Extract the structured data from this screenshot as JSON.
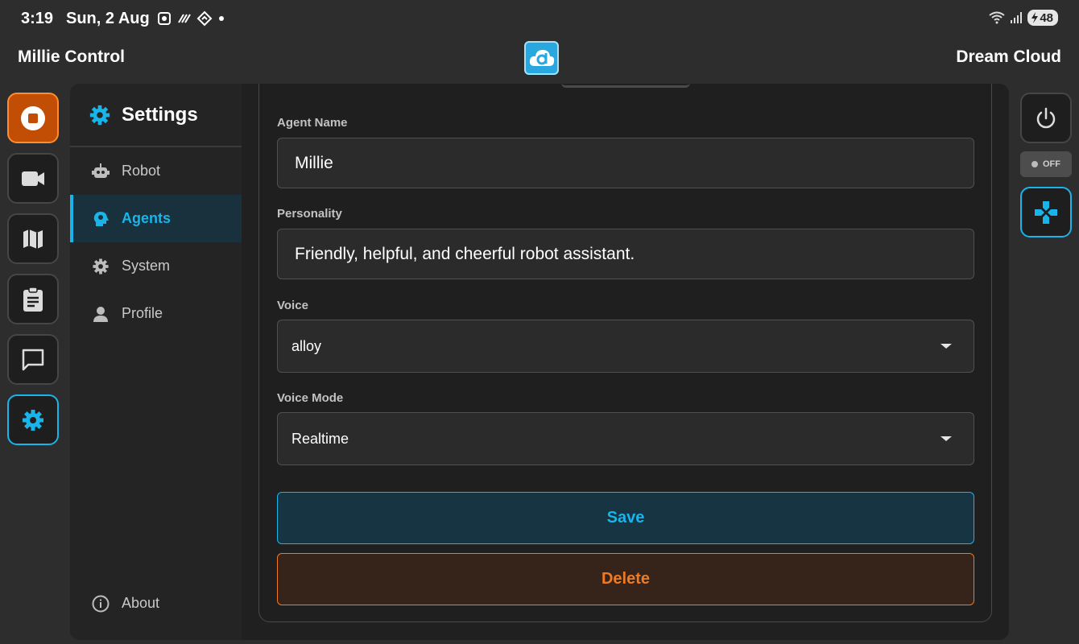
{
  "status_bar": {
    "time": "3:19",
    "date": "Sun, 2 Aug",
    "battery": "48"
  },
  "header": {
    "app_title": "Millie Control",
    "brand": "Dream Cloud",
    "logo_letter": "d"
  },
  "left_nav": [
    "stop",
    "camera",
    "map",
    "tasks",
    "chat",
    "settings"
  ],
  "settings": {
    "title": "Settings",
    "items": [
      {
        "label": "Robot",
        "icon": "robot-icon"
      },
      {
        "label": "Agents",
        "icon": "agent-icon",
        "active": true
      },
      {
        "label": "System",
        "icon": "gear-icon"
      },
      {
        "label": "Profile",
        "icon": "person-icon"
      }
    ],
    "about": "About"
  },
  "form": {
    "agent_name_label": "Agent Name",
    "agent_name_value": "Millie",
    "personality_label": "Personality",
    "personality_value": "Friendly, helpful, and cheerful robot assistant.",
    "voice_label": "Voice",
    "voice_value": "alloy",
    "voice_mode_label": "Voice Mode",
    "voice_mode_value": "Realtime",
    "save_label": "Save",
    "delete_label": "Delete"
  },
  "right_panel": {
    "toggle_label": "OFF"
  },
  "colors": {
    "accent": "#19b4ea",
    "danger": "#f07a22",
    "stop": "#c24d05"
  }
}
